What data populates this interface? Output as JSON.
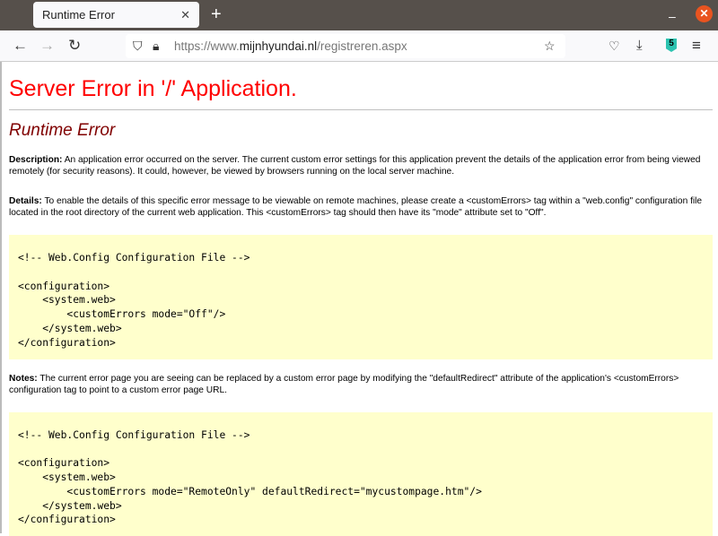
{
  "browser": {
    "tab_title": "Runtime Error",
    "url_prefix": "https://www.",
    "url_domain": "mijnhyundai.nl",
    "url_path": "/registreren.aspx",
    "extension_badge": "5"
  },
  "page": {
    "title": "Server Error in '/' Application.",
    "subtitle": "Runtime Error",
    "description_label": "Description:",
    "description_text": " An application error occurred on the server. The current custom error settings for this application prevent the details of the application error from being viewed remotely (for security reasons). It could, however, be viewed by browsers running on the local server machine.",
    "details_label": "Details:",
    "details_text": " To enable the details of this specific error message to be viewable on remote machines, please create a <customErrors> tag within a \"web.config\" configuration file located in the root directory of the current web application. This <customErrors> tag should then have its \"mode\" attribute set to \"Off\".",
    "code1": "<!-- Web.Config Configuration File -->\n\n<configuration>\n    <system.web>\n        <customErrors mode=\"Off\"/>\n    </system.web>\n</configuration>",
    "notes_label": "Notes:",
    "notes_text": " The current error page you are seeing can be replaced by a custom error page by modifying the \"defaultRedirect\" attribute of the application's <customErrors> configuration tag to point to a custom error page URL.",
    "code2": "<!-- Web.Config Configuration File -->\n\n<configuration>\n    <system.web>\n        <customErrors mode=\"RemoteOnly\" defaultRedirect=\"mycustompage.htm\"/>\n    </system.web>\n</configuration>"
  }
}
